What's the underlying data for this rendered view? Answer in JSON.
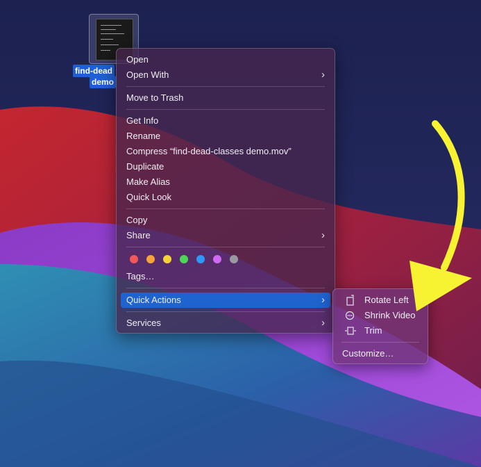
{
  "desktop_file": {
    "label_line1": "find-dead",
    "label_line2": "demo"
  },
  "context_menu": {
    "open": "Open",
    "open_with": "Open With",
    "move_to_trash": "Move to Trash",
    "get_info": "Get Info",
    "rename": "Rename",
    "compress": "Compress “find-dead-classes demo.mov”",
    "duplicate": "Duplicate",
    "make_alias": "Make Alias",
    "quick_look": "Quick Look",
    "copy": "Copy",
    "share": "Share",
    "tag_colors": [
      "#f0595a",
      "#f5a33a",
      "#f6d23a",
      "#4fd659",
      "#2f97f6",
      "#cd6cf2",
      "#9a98a0"
    ],
    "tags": "Tags…",
    "quick_actions": "Quick Actions",
    "services": "Services"
  },
  "quick_actions_submenu": {
    "rotate_left": "Rotate Left",
    "shrink_video": "Shrink Video",
    "trim": "Trim",
    "customize": "Customize…"
  },
  "colors": {
    "highlight": "#1f63cf",
    "annotation_arrow": "#f8f332"
  }
}
